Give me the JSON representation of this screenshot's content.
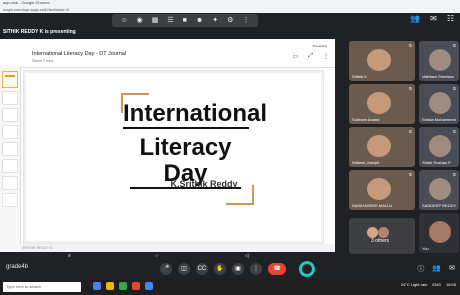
{
  "window": {
    "title": "aqn-zwk - Google Chrome",
    "url": "oogle.com/aqn-wpjz-zwk?authuser=0",
    "presenting_text": "SITHIK REDDY K is presenting"
  },
  "top_toolbar": {
    "icons": [
      "smiley-icon",
      "eye-icon",
      "grid-icon",
      "note-icon",
      "square-icon",
      "person-icon",
      "spark-icon",
      "settings-icon",
      "dots-icon"
    ]
  },
  "top_right": {
    "icons": [
      "people-icon",
      "chat-icon",
      "activities-icon"
    ]
  },
  "slides_ui": {
    "doc_title": "International Literacy Day - DT Journal",
    "doc_subtitle": "Saved 2 mins",
    "meta": "Presenting",
    "slide_title_line1": "International",
    "slide_title_line2": "Literacy Day",
    "slide_author": "K.Srithik Reddy",
    "footer_text": "SRITHIK REDDY K"
  },
  "participants": [
    {
      "name": "Srithik K",
      "col": "left",
      "row": 0
    },
    {
      "name": "Vaibhavi Sheelam",
      "col": "right",
      "row": 0
    },
    {
      "name": "Subham Anand",
      "col": "left",
      "row": 1
    },
    {
      "name": "Sridda Mohammed",
      "col": "right",
      "row": 1
    },
    {
      "name": "Srikesh Joseph",
      "col": "left",
      "row": 2
    },
    {
      "name": "Shahi Roshan P",
      "col": "right",
      "row": 2
    },
    {
      "name": "NAISHASREE MALLU",
      "col": "left",
      "row": 3
    },
    {
      "name": "SANDEEP REDDY",
      "col": "right",
      "row": 3
    }
  ],
  "others_tile": {
    "label": "3 others"
  },
  "self_tile": {
    "label": "You"
  },
  "bottom_bar": {
    "meeting_code": "grade4b",
    "controls": [
      "mic-icon",
      "camera-icon",
      "caption-icon",
      "hand-icon",
      "present-icon",
      "more-icon"
    ],
    "right_icons": [
      "info-icon",
      "people-icon",
      "chat-icon"
    ],
    "leave_icon": "phone-icon"
  },
  "taskbar": {
    "search_placeholder": "Type here to search",
    "weather": "24°C Light rain",
    "lang": "ENG",
    "time": "16:05"
  },
  "pager": {
    "left": "≡",
    "center": "○",
    "right": "◁"
  }
}
